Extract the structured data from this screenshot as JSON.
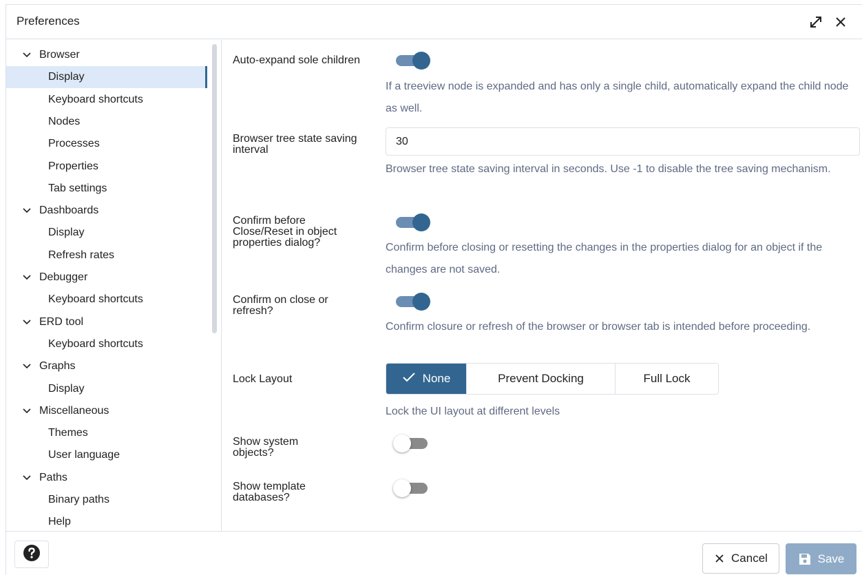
{
  "dialog": {
    "title": "Preferences"
  },
  "sidebar": {
    "groups": [
      {
        "label": "Browser",
        "items": [
          "Display",
          "Keyboard shortcuts",
          "Nodes",
          "Processes",
          "Properties",
          "Tab settings"
        ]
      },
      {
        "label": "Dashboards",
        "items": [
          "Display",
          "Refresh rates"
        ]
      },
      {
        "label": "Debugger",
        "items": [
          "Keyboard shortcuts"
        ]
      },
      {
        "label": "ERD tool",
        "items": [
          "Keyboard shortcuts"
        ]
      },
      {
        "label": "Graphs",
        "items": [
          "Display"
        ]
      },
      {
        "label": "Miscellaneous",
        "items": [
          "Themes",
          "User language"
        ]
      },
      {
        "label": "Paths",
        "items": [
          "Binary paths",
          "Help"
        ]
      }
    ],
    "selected": "Browser / Display"
  },
  "settings": {
    "auto_expand": {
      "label": "Auto-expand sole children",
      "enabled": true,
      "help": "If a treeview node is expanded and has only a single child, automatically expand the child node as well."
    },
    "tree_state_interval": {
      "label": "Browser tree state saving interval",
      "value": "30",
      "help": "Browser tree state saving interval in seconds. Use -1 to disable the tree saving mechanism."
    },
    "confirm_close_reset": {
      "label": "Confirm before Close/Reset in object properties dialog?",
      "enabled": true,
      "help": "Confirm before closing or resetting the changes in the properties dialog for an object if the changes are not saved."
    },
    "confirm_on_close": {
      "label": "Confirm on close or refresh?",
      "enabled": true,
      "help": "Confirm closure or refresh of the browser or browser tab is intended before proceeding."
    },
    "lock_layout": {
      "label": "Lock Layout",
      "options": [
        "None",
        "Prevent Docking",
        "Full Lock"
      ],
      "selected": "None",
      "help": "Lock the UI layout at different levels"
    },
    "show_system_objects": {
      "label": "Show system objects?",
      "enabled": false
    },
    "show_template_databases": {
      "label": "Show template databases?",
      "enabled": false
    }
  },
  "footer": {
    "cancel_label": "Cancel",
    "save_label": "Save"
  },
  "colors": {
    "accent": "#326690",
    "accent_light": "#6b8db3",
    "selected_row": "#dde9f8",
    "help_text": "#5f6a83",
    "save_disabled": "#8fabc7",
    "border": "#dde0e6"
  },
  "icons": {
    "expand": "expand-icon",
    "close": "close-icon",
    "chevron": "chevron-down-icon",
    "help": "help-icon",
    "cancel": "close-icon",
    "save": "floppy-disk-icon",
    "check": "check-icon"
  }
}
